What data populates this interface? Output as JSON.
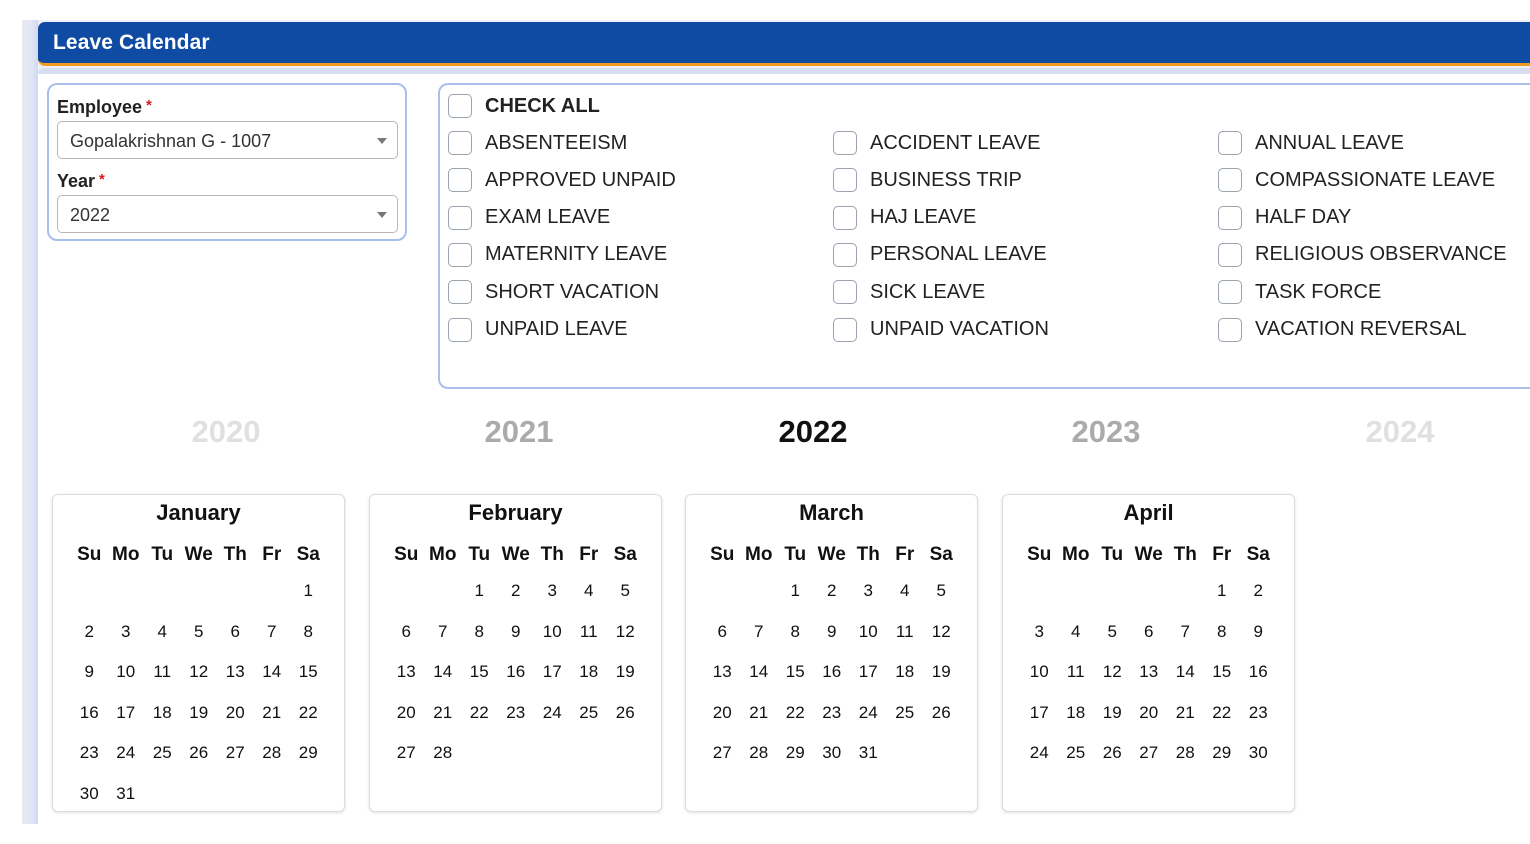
{
  "panel": {
    "title": "Leave Calendar"
  },
  "colors": {
    "header_bg": "#0f4aa3",
    "header_accent": "#f39a21",
    "box_border": "#a8bfe9",
    "required": "#e0161e"
  },
  "filters": {
    "employee": {
      "label": "Employee",
      "required_mark": "*",
      "value": "Gopalakrishnan G - 1007"
    },
    "year": {
      "label": "Year",
      "required_mark": "*",
      "value": "2022"
    }
  },
  "leave_types": {
    "check_all": {
      "label": "CHECK ALL",
      "checked": false
    },
    "items": [
      {
        "label": "ABSENTEEISM",
        "checked": false
      },
      {
        "label": "ACCIDENT LEAVE",
        "checked": false
      },
      {
        "label": "ANNUAL LEAVE",
        "checked": false
      },
      {
        "label": "APPROVED UNPAID",
        "checked": false
      },
      {
        "label": "BUSINESS TRIP",
        "checked": false
      },
      {
        "label": "COMPASSIONATE LEAVE",
        "checked": false
      },
      {
        "label": "EXAM LEAVE",
        "checked": false
      },
      {
        "label": "HAJ LEAVE",
        "checked": false
      },
      {
        "label": "HALF DAY",
        "checked": false
      },
      {
        "label": "MATERNITY LEAVE",
        "checked": false
      },
      {
        "label": "PERSONAL LEAVE",
        "checked": false
      },
      {
        "label": "RELIGIOUS OBSERVANCE",
        "checked": false
      },
      {
        "label": "SHORT VACATION",
        "checked": false
      },
      {
        "label": "SICK LEAVE",
        "checked": false
      },
      {
        "label": "TASK FORCE",
        "checked": false
      },
      {
        "label": "UNPAID LEAVE",
        "checked": false
      },
      {
        "label": "UNPAID VACATION",
        "checked": false
      },
      {
        "label": "VACATION REVERSAL",
        "checked": false
      }
    ]
  },
  "year_nav": [
    {
      "label": "2020",
      "state": "far"
    },
    {
      "label": "2021",
      "state": "near"
    },
    {
      "label": "2022",
      "state": "current"
    },
    {
      "label": "2023",
      "state": "near"
    },
    {
      "label": "2024",
      "state": "far"
    }
  ],
  "weekdays": [
    "Su",
    "Mo",
    "Tu",
    "We",
    "Th",
    "Fr",
    "Sa"
  ],
  "months": [
    {
      "name": "January",
      "first_weekday": 6,
      "days": 31
    },
    {
      "name": "February",
      "first_weekday": 2,
      "days": 28
    },
    {
      "name": "March",
      "first_weekday": 2,
      "days": 31
    },
    {
      "name": "April",
      "first_weekday": 5,
      "days": 30
    }
  ]
}
